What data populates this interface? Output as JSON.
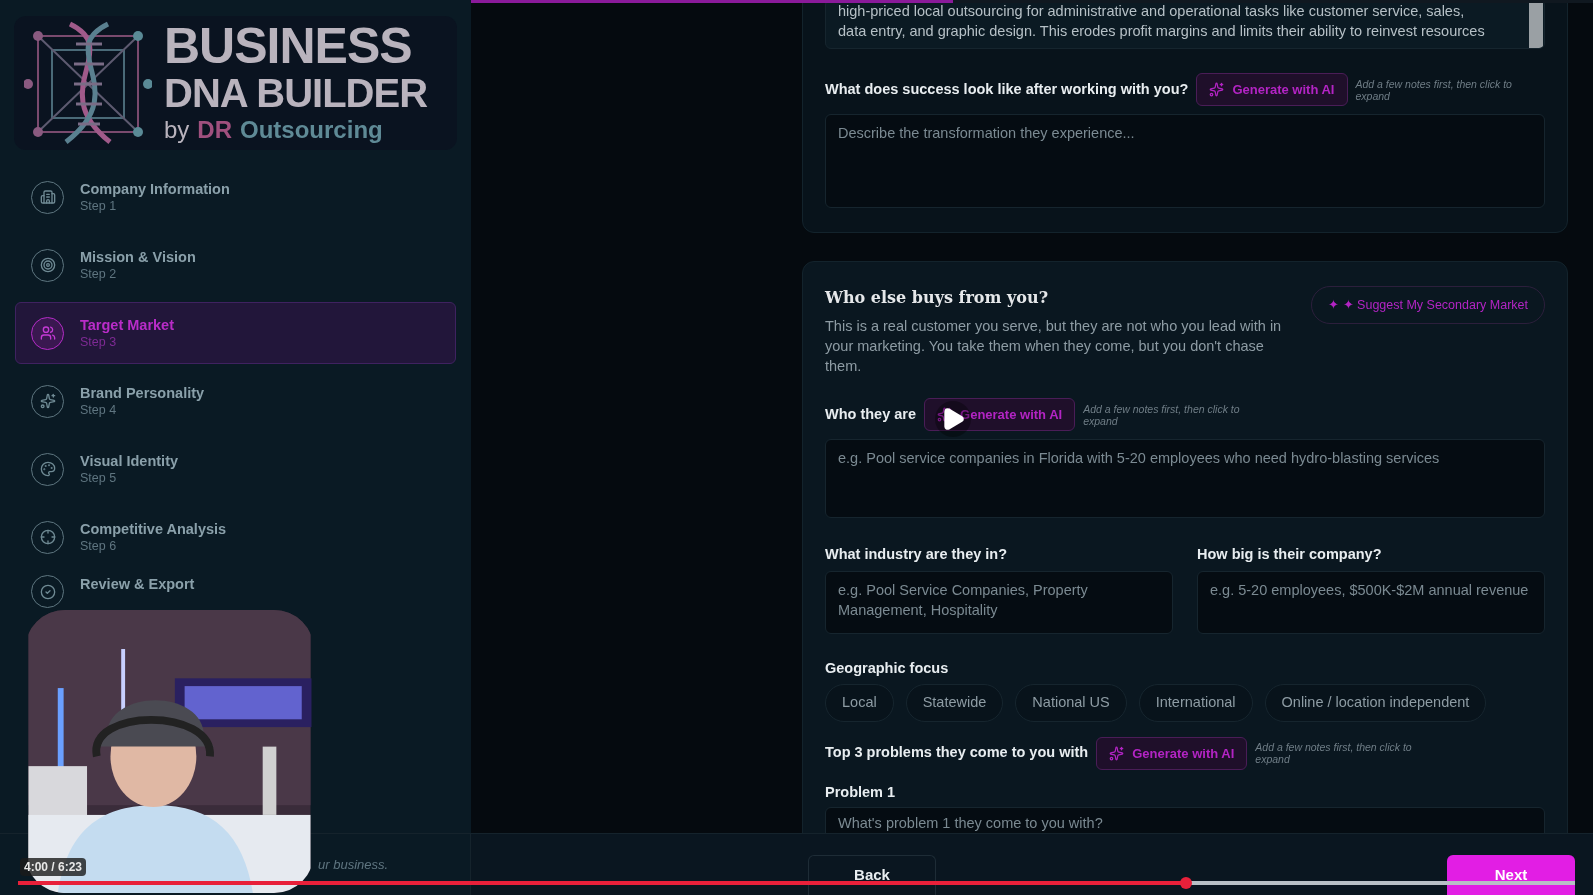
{
  "logo": {
    "line1": "BUSINESS",
    "line2": "DNA BUILDER",
    "by": "by",
    "brand_a": "DR",
    "brand_b": "Outsourcing"
  },
  "steps": [
    {
      "title": "Company Information",
      "step": "Step 1",
      "selected": false
    },
    {
      "title": "Mission & Vision",
      "step": "Step 2",
      "selected": false
    },
    {
      "title": "Target Market",
      "step": "Step 3",
      "selected": true
    },
    {
      "title": "Brand Personality",
      "step": "Step 4",
      "selected": false
    },
    {
      "title": "Visual Identity",
      "step": "Step 5",
      "selected": false
    },
    {
      "title": "Competitive Analysis",
      "step": "Step 6",
      "selected": false
    },
    {
      "title": "Review & Export",
      "selected": false
    }
  ],
  "sidebar_footer": "ur business.",
  "form_progress": {
    "level": 0.43
  },
  "primary_card": {
    "problem_text_lines": [
      "high-priced local outsourcing for administrative and operational tasks like customer service, sales,",
      "data entry, and graphic design. This erodes profit margins and limits their ability to reinvest resources"
    ],
    "success_label": "What does success look like after working with you?",
    "generate_button": "Generate with AI",
    "hint": "Add a few notes first, then click to expand",
    "success_placeholder": "Describe the transformation they experience..."
  },
  "secondary_card": {
    "title": "Who else buys from you?",
    "description": "This is a real customer you serve, but they are not who you lead with in your marketing. You take them when they come, but you don't chase them.",
    "suggest_button": "✦ ✦ Suggest My Secondary Market",
    "who_label": "Who they are",
    "who_generate_button": "Generate with AI",
    "who_hint": "Add a few notes first, then click to expand",
    "who_placeholder": "e.g. Pool service companies in Florida with 5-20 employees who need hydro-blasting services",
    "industry_label": "What industry are they in?",
    "industry_placeholder": "e.g. Pool Service Companies, Property Management, Hospitality",
    "size_label": "How big is their company?",
    "size_placeholder": "e.g. 5-20 employees, $500K-$2M annual revenue",
    "geo_label": "Geographic focus",
    "geo_options": [
      {
        "label": "Local",
        "selected": false
      },
      {
        "label": "Statewide",
        "selected": false
      },
      {
        "label": "National US",
        "selected": false
      },
      {
        "label": "International",
        "selected": false
      },
      {
        "label": "Online / location independent",
        "selected": false
      }
    ],
    "problems_label": "Top 3 problems they come to you with",
    "problems_generate_button": "Generate with AI",
    "problems_hint": "Add a few notes first, then click to expand",
    "problem1_label": "Problem 1",
    "problem1_placeholder": "What's problem 1 they come to you with?"
  },
  "nav": {
    "back": "Back",
    "next": "Next"
  },
  "video": {
    "time": "4:00 / 6:23",
    "progress": {
      "level": 0.75
    }
  }
}
